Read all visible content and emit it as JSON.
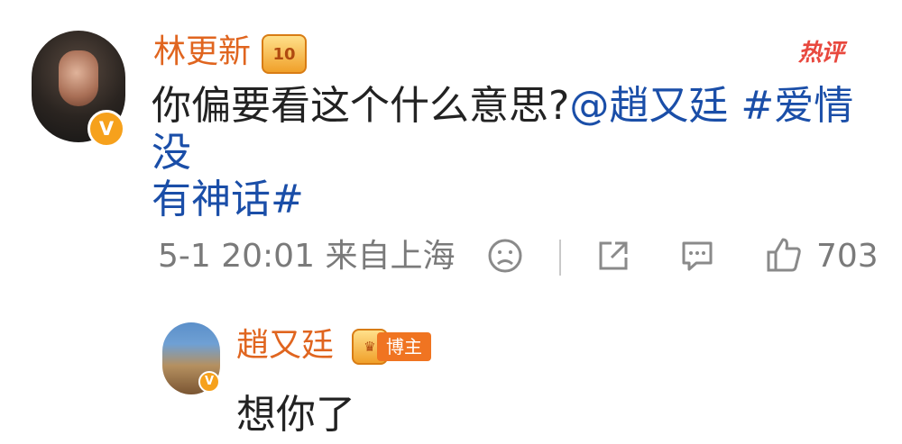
{
  "comment": {
    "username": "林更新",
    "crown_badge_text": "10",
    "hot_label": "热评",
    "text_plain": "你偏要看这个什么意思?",
    "mention": "@趙又廷",
    "hashtag_part1": "#爱情没",
    "hashtag_part2": "有神话#",
    "time": "5-1 20:01",
    "location": "来自上海",
    "likes": "703",
    "icons": [
      "sad-face-icon",
      "share-icon",
      "comment-icon",
      "thumb-up-icon"
    ]
  },
  "reply": {
    "username": "趙又廷",
    "badge_label": "博主",
    "text": "想你了"
  },
  "colors": {
    "username": "#e0651f",
    "link": "#1a4ea8",
    "hot": "#e8483e",
    "badge": "#f07421",
    "verified": "#f6a11c",
    "meta": "#7a7a7a"
  }
}
